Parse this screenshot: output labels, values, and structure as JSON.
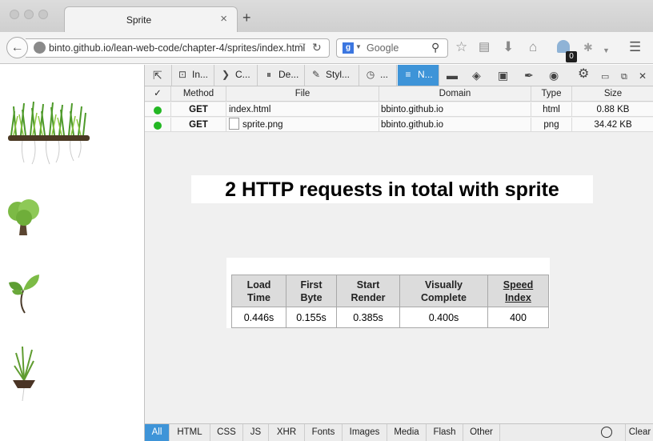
{
  "browser": {
    "tab_title": "Sprite",
    "tab_close": "×",
    "new_tab": "+",
    "url": "bbinto.github.io/lean-web-code/chapter-4/sprites/index.html",
    "url_display": "binto.github.io/lean-web-code/chapter-4/sprites/index.html",
    "search_engine": "Google",
    "search_placeholder": "Google",
    "notification_count": "0"
  },
  "devtools": {
    "tabs": [
      {
        "label": "In...",
        "icon": "inspector-icon"
      },
      {
        "label": "C...",
        "icon": "console-icon"
      },
      {
        "label": "De...",
        "icon": "debugger-icon"
      },
      {
        "label": "Styl...",
        "icon": "style-editor-icon"
      },
      {
        "label": "...",
        "icon": "profiler-icon"
      },
      {
        "label": "N...",
        "icon": "network-icon",
        "active": true
      }
    ],
    "network": {
      "headers": {
        "status": "✓",
        "method": "Method",
        "file": "File",
        "domain": "Domain",
        "type": "Type",
        "size": "Size"
      },
      "requests": [
        {
          "method": "GET",
          "file": "index.html",
          "domain": "bbinto.github.io",
          "type": "html",
          "size": "0.88 KB"
        },
        {
          "method": "GET",
          "file": "sprite.png",
          "domain": "bbinto.github.io",
          "type": "png",
          "size": "34.42 KB"
        }
      ]
    },
    "filters": [
      "All",
      "HTML",
      "CSS",
      "JS",
      "XHR",
      "Fonts",
      "Images",
      "Media",
      "Flash",
      "Other"
    ],
    "clear_label": "Clear"
  },
  "overlay": {
    "banner": "2 HTTP requests in total with sprite",
    "perf_table": {
      "headers": [
        "Load Time",
        "First Byte",
        "Start Render",
        "Visually Complete",
        "Speed Index"
      ],
      "values": [
        "0.446s",
        "0.155s",
        "0.385s",
        "0.400s",
        "400"
      ]
    }
  }
}
